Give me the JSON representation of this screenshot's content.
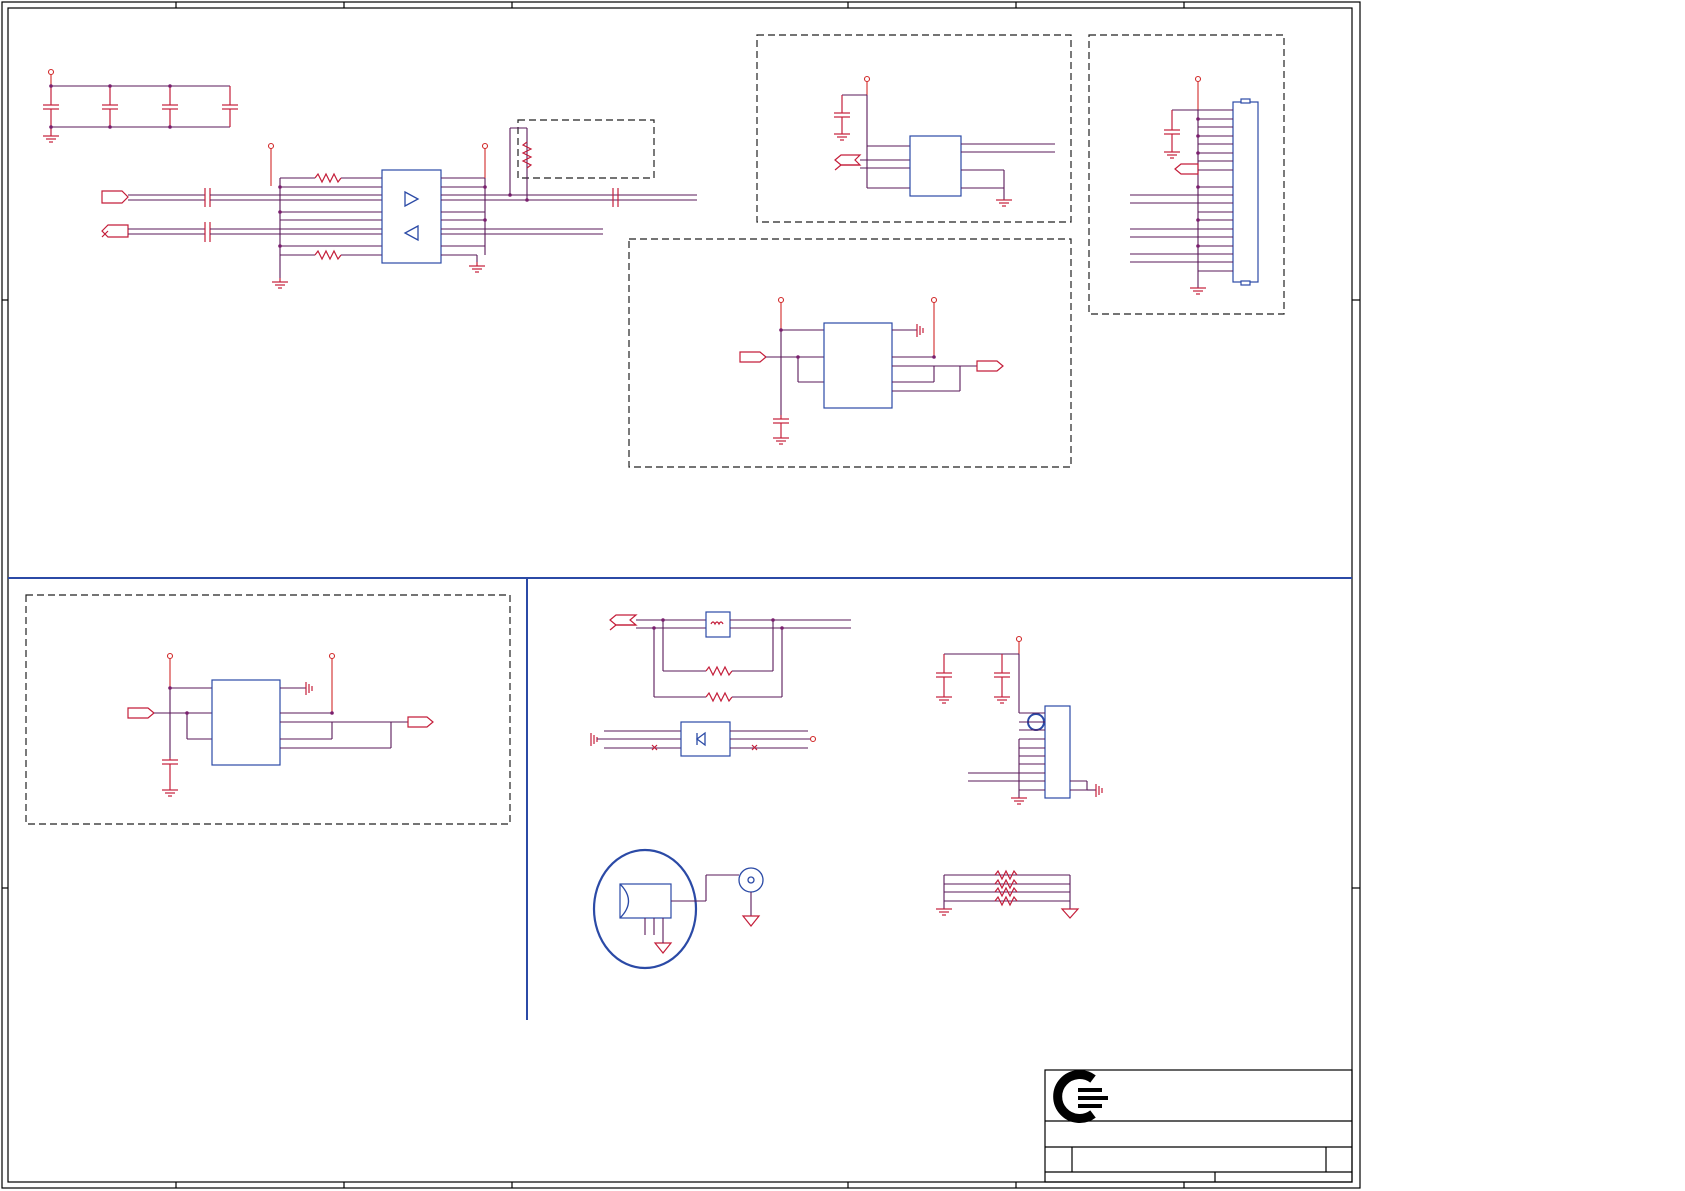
{
  "sheet": {
    "logo": "company-logo-icon",
    "colors": {
      "wire": "#c41e3a",
      "net": "#5a1a5a",
      "component": "#2b4aa6",
      "frame": "#000000"
    }
  }
}
